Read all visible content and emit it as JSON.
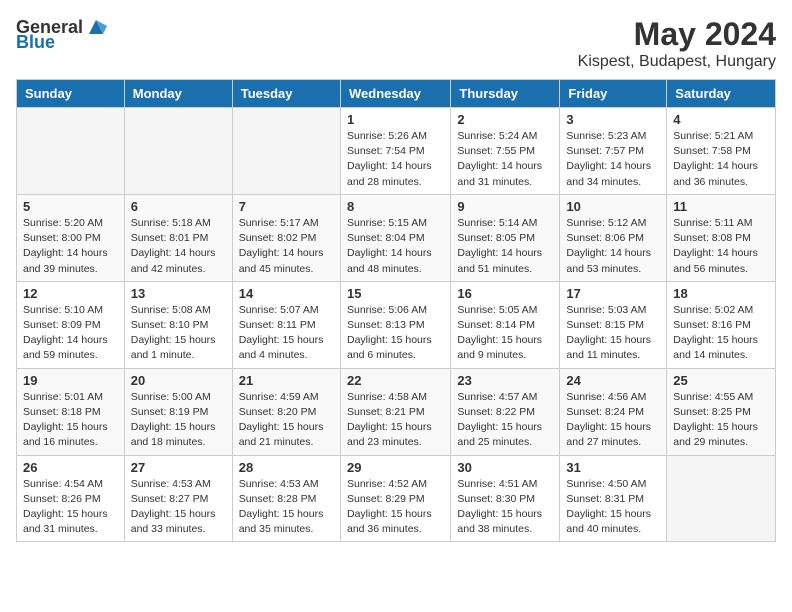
{
  "header": {
    "logo_general": "General",
    "logo_blue": "Blue",
    "month": "May 2024",
    "location": "Kispest, Budapest, Hungary"
  },
  "weekdays": [
    "Sunday",
    "Monday",
    "Tuesday",
    "Wednesday",
    "Thursday",
    "Friday",
    "Saturday"
  ],
  "weeks": [
    [
      {
        "day": "",
        "info": ""
      },
      {
        "day": "",
        "info": ""
      },
      {
        "day": "",
        "info": ""
      },
      {
        "day": "1",
        "info": "Sunrise: 5:26 AM\nSunset: 7:54 PM\nDaylight: 14 hours\nand 28 minutes."
      },
      {
        "day": "2",
        "info": "Sunrise: 5:24 AM\nSunset: 7:55 PM\nDaylight: 14 hours\nand 31 minutes."
      },
      {
        "day": "3",
        "info": "Sunrise: 5:23 AM\nSunset: 7:57 PM\nDaylight: 14 hours\nand 34 minutes."
      },
      {
        "day": "4",
        "info": "Sunrise: 5:21 AM\nSunset: 7:58 PM\nDaylight: 14 hours\nand 36 minutes."
      }
    ],
    [
      {
        "day": "5",
        "info": "Sunrise: 5:20 AM\nSunset: 8:00 PM\nDaylight: 14 hours\nand 39 minutes."
      },
      {
        "day": "6",
        "info": "Sunrise: 5:18 AM\nSunset: 8:01 PM\nDaylight: 14 hours\nand 42 minutes."
      },
      {
        "day": "7",
        "info": "Sunrise: 5:17 AM\nSunset: 8:02 PM\nDaylight: 14 hours\nand 45 minutes."
      },
      {
        "day": "8",
        "info": "Sunrise: 5:15 AM\nSunset: 8:04 PM\nDaylight: 14 hours\nand 48 minutes."
      },
      {
        "day": "9",
        "info": "Sunrise: 5:14 AM\nSunset: 8:05 PM\nDaylight: 14 hours\nand 51 minutes."
      },
      {
        "day": "10",
        "info": "Sunrise: 5:12 AM\nSunset: 8:06 PM\nDaylight: 14 hours\nand 53 minutes."
      },
      {
        "day": "11",
        "info": "Sunrise: 5:11 AM\nSunset: 8:08 PM\nDaylight: 14 hours\nand 56 minutes."
      }
    ],
    [
      {
        "day": "12",
        "info": "Sunrise: 5:10 AM\nSunset: 8:09 PM\nDaylight: 14 hours\nand 59 minutes."
      },
      {
        "day": "13",
        "info": "Sunrise: 5:08 AM\nSunset: 8:10 PM\nDaylight: 15 hours\nand 1 minute."
      },
      {
        "day": "14",
        "info": "Sunrise: 5:07 AM\nSunset: 8:11 PM\nDaylight: 15 hours\nand 4 minutes."
      },
      {
        "day": "15",
        "info": "Sunrise: 5:06 AM\nSunset: 8:13 PM\nDaylight: 15 hours\nand 6 minutes."
      },
      {
        "day": "16",
        "info": "Sunrise: 5:05 AM\nSunset: 8:14 PM\nDaylight: 15 hours\nand 9 minutes."
      },
      {
        "day": "17",
        "info": "Sunrise: 5:03 AM\nSunset: 8:15 PM\nDaylight: 15 hours\nand 11 minutes."
      },
      {
        "day": "18",
        "info": "Sunrise: 5:02 AM\nSunset: 8:16 PM\nDaylight: 15 hours\nand 14 minutes."
      }
    ],
    [
      {
        "day": "19",
        "info": "Sunrise: 5:01 AM\nSunset: 8:18 PM\nDaylight: 15 hours\nand 16 minutes."
      },
      {
        "day": "20",
        "info": "Sunrise: 5:00 AM\nSunset: 8:19 PM\nDaylight: 15 hours\nand 18 minutes."
      },
      {
        "day": "21",
        "info": "Sunrise: 4:59 AM\nSunset: 8:20 PM\nDaylight: 15 hours\nand 21 minutes."
      },
      {
        "day": "22",
        "info": "Sunrise: 4:58 AM\nSunset: 8:21 PM\nDaylight: 15 hours\nand 23 minutes."
      },
      {
        "day": "23",
        "info": "Sunrise: 4:57 AM\nSunset: 8:22 PM\nDaylight: 15 hours\nand 25 minutes."
      },
      {
        "day": "24",
        "info": "Sunrise: 4:56 AM\nSunset: 8:24 PM\nDaylight: 15 hours\nand 27 minutes."
      },
      {
        "day": "25",
        "info": "Sunrise: 4:55 AM\nSunset: 8:25 PM\nDaylight: 15 hours\nand 29 minutes."
      }
    ],
    [
      {
        "day": "26",
        "info": "Sunrise: 4:54 AM\nSunset: 8:26 PM\nDaylight: 15 hours\nand 31 minutes."
      },
      {
        "day": "27",
        "info": "Sunrise: 4:53 AM\nSunset: 8:27 PM\nDaylight: 15 hours\nand 33 minutes."
      },
      {
        "day": "28",
        "info": "Sunrise: 4:53 AM\nSunset: 8:28 PM\nDaylight: 15 hours\nand 35 minutes."
      },
      {
        "day": "29",
        "info": "Sunrise: 4:52 AM\nSunset: 8:29 PM\nDaylight: 15 hours\nand 36 minutes."
      },
      {
        "day": "30",
        "info": "Sunrise: 4:51 AM\nSunset: 8:30 PM\nDaylight: 15 hours\nand 38 minutes."
      },
      {
        "day": "31",
        "info": "Sunrise: 4:50 AM\nSunset: 8:31 PM\nDaylight: 15 hours\nand 40 minutes."
      },
      {
        "day": "",
        "info": ""
      }
    ]
  ]
}
